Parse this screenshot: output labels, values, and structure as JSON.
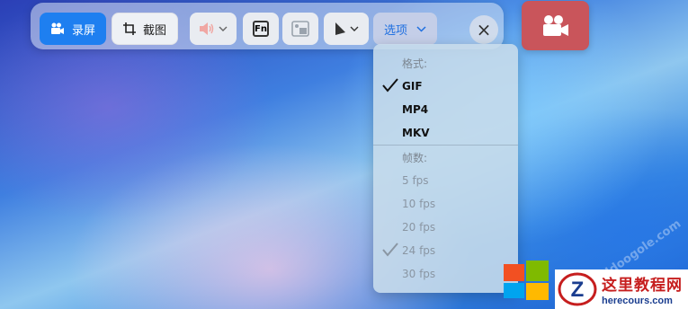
{
  "toolbar": {
    "record_label": "录屏",
    "screenshot_label": "截图",
    "fn_label": "Fn",
    "options_label": "选项",
    "close_symbol": "×"
  },
  "menu": {
    "format_header": "格式:",
    "formats": [
      "GIF",
      "MP4",
      "MKV"
    ],
    "selected_format": "GIF",
    "fps_header": "帧数:",
    "fps_options": [
      "5 fps",
      "10 fps",
      "20 fps",
      "24 fps",
      "30 fps"
    ],
    "selected_fps": "24 fps"
  },
  "watermark": {
    "site_title": "这里教程网",
    "site_url": "herecours.com",
    "ghost_text": "ddoogole.com"
  },
  "colors": {
    "accent": "#1e7ff0",
    "record_button": "#c9555b"
  },
  "icons": [
    "video-camera-icon",
    "crop-icon",
    "speaker-icon",
    "chevron-down-icon",
    "fn-key-icon",
    "webcam-icon",
    "cursor-icon",
    "close-icon",
    "checkmark-icon",
    "windows-logo-icon"
  ]
}
